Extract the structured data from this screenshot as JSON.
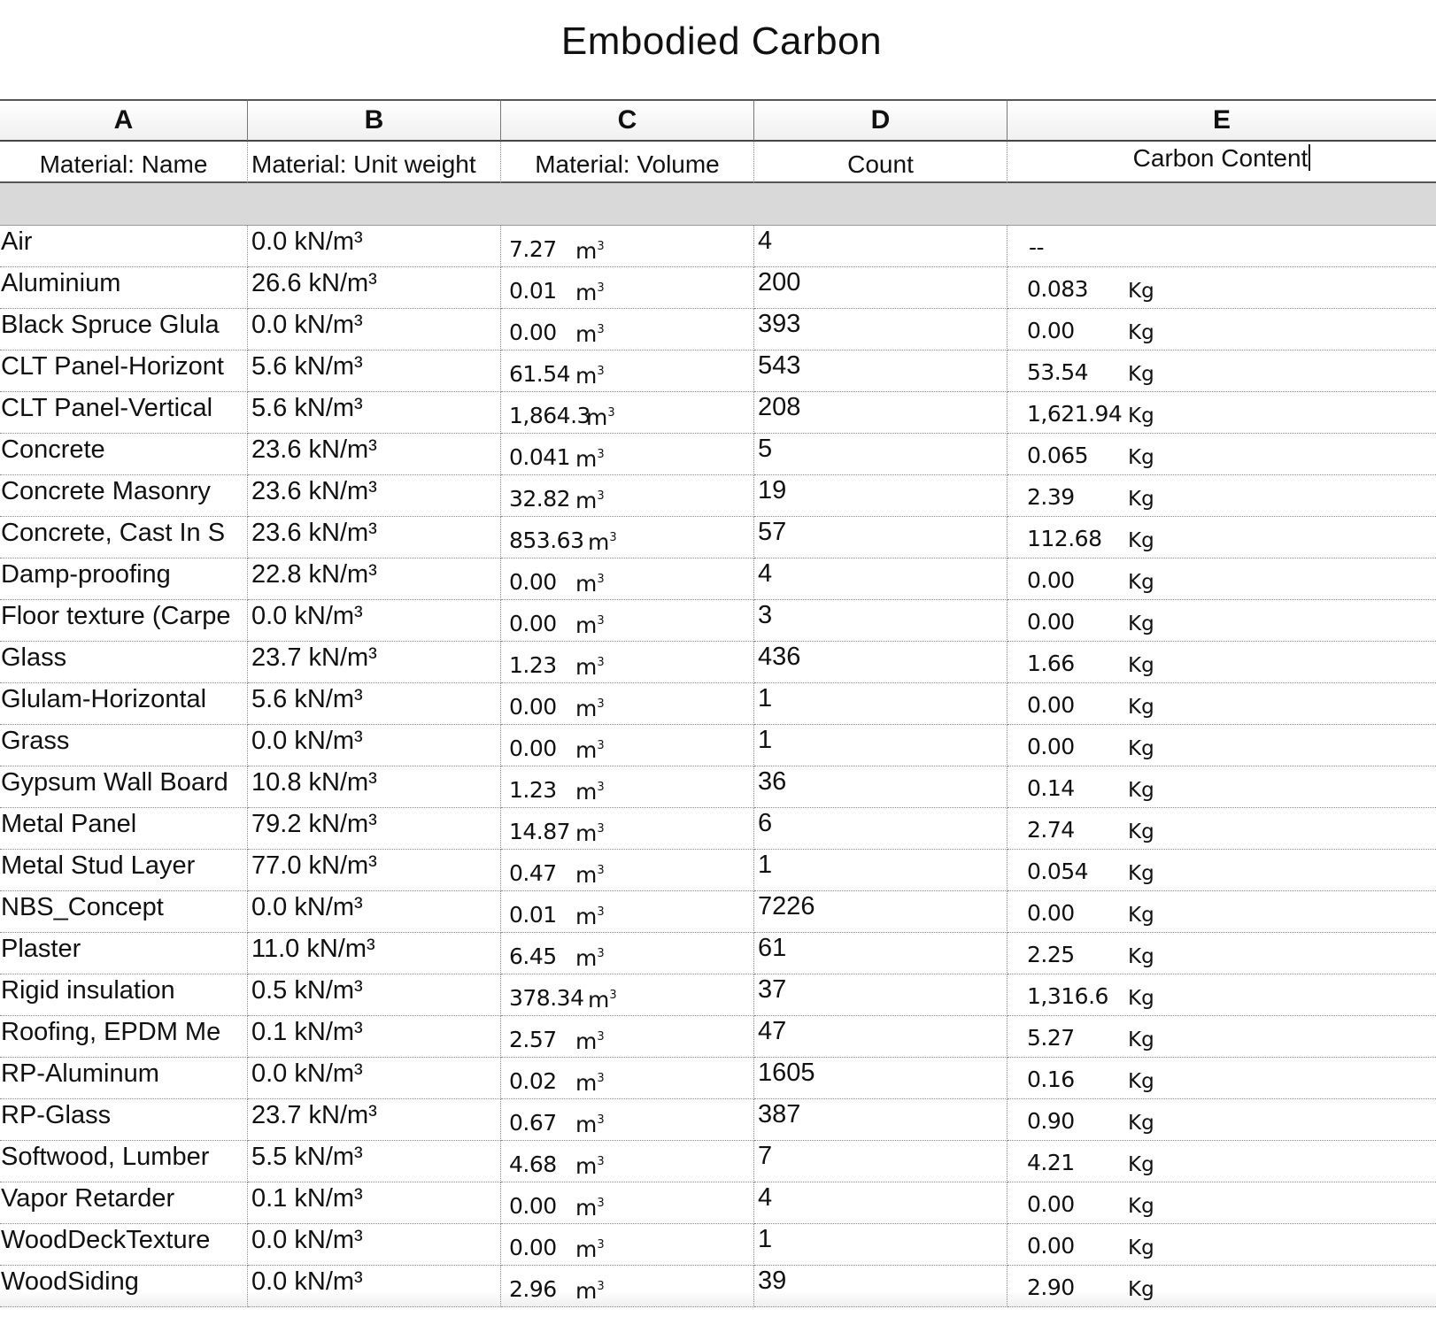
{
  "title": "Embodied Carbon",
  "columns": {
    "letters": [
      "A",
      "B",
      "C",
      "D",
      "E"
    ],
    "fields": [
      "Material: Name",
      "Material: Unit weight",
      "Material: Volume",
      "Count",
      "Carbon Content"
    ]
  },
  "units": {
    "volume": "m",
    "volume_exp": "3",
    "carbon": "Kg"
  },
  "rows": [
    {
      "name": "Air",
      "unit_weight": "0.0 kN/m³",
      "volume": "7.27",
      "count": "4",
      "carbon": "--",
      "carbon_unit": ""
    },
    {
      "name": "Aluminium",
      "unit_weight": "26.6 kN/m³",
      "volume": "0.01",
      "count": "200",
      "carbon": "0.083",
      "carbon_unit": "Kg"
    },
    {
      "name": "Black Spruce Glula",
      "unit_weight": "0.0 kN/m³",
      "volume": "0.00",
      "count": "393",
      "carbon": "0.00",
      "carbon_unit": "Kg"
    },
    {
      "name": "CLT Panel-Horizont",
      "unit_weight": "5.6 kN/m³",
      "volume": "61.54",
      "count": "543",
      "carbon": "53.54",
      "carbon_unit": "Kg"
    },
    {
      "name": "CLT Panel-Vertical",
      "unit_weight": "5.6 kN/m³",
      "volume": "1,864.3",
      "count": "208",
      "carbon": "1,621.94",
      "carbon_unit": "Kg"
    },
    {
      "name": "Concrete",
      "unit_weight": "23.6 kN/m³",
      "volume": "0.041",
      "count": "5",
      "carbon": "0.065",
      "carbon_unit": "Kg"
    },
    {
      "name": "Concrete Masonry",
      "unit_weight": "23.6 kN/m³",
      "volume": "32.82",
      "count": "19",
      "carbon": "2.39",
      "carbon_unit": "Kg"
    },
    {
      "name": "Concrete, Cast In S",
      "unit_weight": "23.6 kN/m³",
      "volume": "853.63",
      "count": "57",
      "carbon": "112.68",
      "carbon_unit": "Kg"
    },
    {
      "name": "Damp-proofing",
      "unit_weight": "22.8 kN/m³",
      "volume": "0.00",
      "count": "4",
      "carbon": "0.00",
      "carbon_unit": "Kg"
    },
    {
      "name": "Floor texture (Carpe",
      "unit_weight": "0.0 kN/m³",
      "volume": "0.00",
      "count": "3",
      "carbon": "0.00",
      "carbon_unit": "Kg"
    },
    {
      "name": "Glass",
      "unit_weight": "23.7 kN/m³",
      "volume": "1.23",
      "count": "436",
      "carbon": "1.66",
      "carbon_unit": "Kg"
    },
    {
      "name": "Glulam-Horizontal",
      "unit_weight": "5.6 kN/m³",
      "volume": "0.00",
      "count": "1",
      "carbon": "0.00",
      "carbon_unit": "Kg"
    },
    {
      "name": "Grass",
      "unit_weight": "0.0 kN/m³",
      "volume": "0.00",
      "count": "1",
      "carbon": "0.00",
      "carbon_unit": "Kg"
    },
    {
      "name": "Gypsum Wall Board",
      "unit_weight": "10.8 kN/m³",
      "volume": "1.23",
      "count": "36",
      "carbon": "0.14",
      "carbon_unit": "Kg"
    },
    {
      "name": "Metal Panel",
      "unit_weight": "79.2 kN/m³",
      "volume": "14.87",
      "count": "6",
      "carbon": "2.74",
      "carbon_unit": "Kg"
    },
    {
      "name": "Metal Stud Layer",
      "unit_weight": "77.0 kN/m³",
      "volume": "0.47",
      "count": "1",
      "carbon": "0.054",
      "carbon_unit": "Kg"
    },
    {
      "name": "NBS_Concept",
      "unit_weight": "0.0 kN/m³",
      "volume": "0.01",
      "count": "7226",
      "carbon": "0.00",
      "carbon_unit": "Kg"
    },
    {
      "name": "Plaster",
      "unit_weight": "11.0 kN/m³",
      "volume": "6.45",
      "count": "61",
      "carbon": "2.25",
      "carbon_unit": "Kg"
    },
    {
      "name": "Rigid insulation",
      "unit_weight": "0.5 kN/m³",
      "volume": "378.34",
      "count": "37",
      "carbon": "1,316.6",
      "carbon_unit": "Kg"
    },
    {
      "name": "Roofing, EPDM Me",
      "unit_weight": "0.1 kN/m³",
      "volume": "2.57",
      "count": "47",
      "carbon": "5.27",
      "carbon_unit": "Kg"
    },
    {
      "name": "RP-Aluminum",
      "unit_weight": "0.0 kN/m³",
      "volume": "0.02",
      "count": "1605",
      "carbon": "0.16",
      "carbon_unit": "Kg"
    },
    {
      "name": "RP-Glass",
      "unit_weight": "23.7 kN/m³",
      "volume": "0.67",
      "count": "387",
      "carbon": "0.90",
      "carbon_unit": "Kg"
    },
    {
      "name": "Softwood, Lumber",
      "unit_weight": "5.5 kN/m³",
      "volume": "4.68",
      "count": "7",
      "carbon": "4.21",
      "carbon_unit": "Kg"
    },
    {
      "name": "Vapor Retarder",
      "unit_weight": "0.1 kN/m³",
      "volume": "0.00",
      "count": "4",
      "carbon": "0.00",
      "carbon_unit": "Kg"
    },
    {
      "name": "WoodDeckTexture",
      "unit_weight": "0.0 kN/m³",
      "volume": "0.00",
      "count": "1",
      "carbon": "0.00",
      "carbon_unit": "Kg"
    },
    {
      "name": "WoodSiding",
      "unit_weight": "0.0 kN/m³",
      "volume": "2.96",
      "count": "39",
      "carbon": "2.90",
      "carbon_unit": "Kg"
    }
  ]
}
